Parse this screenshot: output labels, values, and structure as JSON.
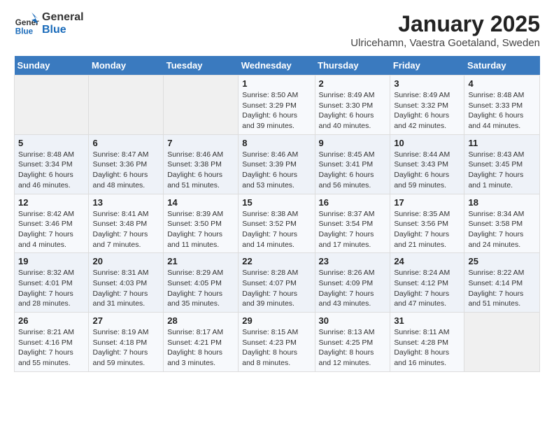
{
  "header": {
    "logo_general": "General",
    "logo_blue": "Blue",
    "title": "January 2025",
    "subtitle": "Ulricehamn, Vaestra Goetaland, Sweden"
  },
  "days_of_week": [
    "Sunday",
    "Monday",
    "Tuesday",
    "Wednesday",
    "Thursday",
    "Friday",
    "Saturday"
  ],
  "weeks": [
    [
      {
        "day": "",
        "info": ""
      },
      {
        "day": "",
        "info": ""
      },
      {
        "day": "",
        "info": ""
      },
      {
        "day": "1",
        "info": "Sunrise: 8:50 AM\nSunset: 3:29 PM\nDaylight: 6 hours and 39 minutes."
      },
      {
        "day": "2",
        "info": "Sunrise: 8:49 AM\nSunset: 3:30 PM\nDaylight: 6 hours and 40 minutes."
      },
      {
        "day": "3",
        "info": "Sunrise: 8:49 AM\nSunset: 3:32 PM\nDaylight: 6 hours and 42 minutes."
      },
      {
        "day": "4",
        "info": "Sunrise: 8:48 AM\nSunset: 3:33 PM\nDaylight: 6 hours and 44 minutes."
      }
    ],
    [
      {
        "day": "5",
        "info": "Sunrise: 8:48 AM\nSunset: 3:34 PM\nDaylight: 6 hours and 46 minutes."
      },
      {
        "day": "6",
        "info": "Sunrise: 8:47 AM\nSunset: 3:36 PM\nDaylight: 6 hours and 48 minutes."
      },
      {
        "day": "7",
        "info": "Sunrise: 8:46 AM\nSunset: 3:38 PM\nDaylight: 6 hours and 51 minutes."
      },
      {
        "day": "8",
        "info": "Sunrise: 8:46 AM\nSunset: 3:39 PM\nDaylight: 6 hours and 53 minutes."
      },
      {
        "day": "9",
        "info": "Sunrise: 8:45 AM\nSunset: 3:41 PM\nDaylight: 6 hours and 56 minutes."
      },
      {
        "day": "10",
        "info": "Sunrise: 8:44 AM\nSunset: 3:43 PM\nDaylight: 6 hours and 59 minutes."
      },
      {
        "day": "11",
        "info": "Sunrise: 8:43 AM\nSunset: 3:45 PM\nDaylight: 7 hours and 1 minute."
      }
    ],
    [
      {
        "day": "12",
        "info": "Sunrise: 8:42 AM\nSunset: 3:46 PM\nDaylight: 7 hours and 4 minutes."
      },
      {
        "day": "13",
        "info": "Sunrise: 8:41 AM\nSunset: 3:48 PM\nDaylight: 7 hours and 7 minutes."
      },
      {
        "day": "14",
        "info": "Sunrise: 8:39 AM\nSunset: 3:50 PM\nDaylight: 7 hours and 11 minutes."
      },
      {
        "day": "15",
        "info": "Sunrise: 8:38 AM\nSunset: 3:52 PM\nDaylight: 7 hours and 14 minutes."
      },
      {
        "day": "16",
        "info": "Sunrise: 8:37 AM\nSunset: 3:54 PM\nDaylight: 7 hours and 17 minutes."
      },
      {
        "day": "17",
        "info": "Sunrise: 8:35 AM\nSunset: 3:56 PM\nDaylight: 7 hours and 21 minutes."
      },
      {
        "day": "18",
        "info": "Sunrise: 8:34 AM\nSunset: 3:58 PM\nDaylight: 7 hours and 24 minutes."
      }
    ],
    [
      {
        "day": "19",
        "info": "Sunrise: 8:32 AM\nSunset: 4:01 PM\nDaylight: 7 hours and 28 minutes."
      },
      {
        "day": "20",
        "info": "Sunrise: 8:31 AM\nSunset: 4:03 PM\nDaylight: 7 hours and 31 minutes."
      },
      {
        "day": "21",
        "info": "Sunrise: 8:29 AM\nSunset: 4:05 PM\nDaylight: 7 hours and 35 minutes."
      },
      {
        "day": "22",
        "info": "Sunrise: 8:28 AM\nSunset: 4:07 PM\nDaylight: 7 hours and 39 minutes."
      },
      {
        "day": "23",
        "info": "Sunrise: 8:26 AM\nSunset: 4:09 PM\nDaylight: 7 hours and 43 minutes."
      },
      {
        "day": "24",
        "info": "Sunrise: 8:24 AM\nSunset: 4:12 PM\nDaylight: 7 hours and 47 minutes."
      },
      {
        "day": "25",
        "info": "Sunrise: 8:22 AM\nSunset: 4:14 PM\nDaylight: 7 hours and 51 minutes."
      }
    ],
    [
      {
        "day": "26",
        "info": "Sunrise: 8:21 AM\nSunset: 4:16 PM\nDaylight: 7 hours and 55 minutes."
      },
      {
        "day": "27",
        "info": "Sunrise: 8:19 AM\nSunset: 4:18 PM\nDaylight: 7 hours and 59 minutes."
      },
      {
        "day": "28",
        "info": "Sunrise: 8:17 AM\nSunset: 4:21 PM\nDaylight: 8 hours and 3 minutes."
      },
      {
        "day": "29",
        "info": "Sunrise: 8:15 AM\nSunset: 4:23 PM\nDaylight: 8 hours and 8 minutes."
      },
      {
        "day": "30",
        "info": "Sunrise: 8:13 AM\nSunset: 4:25 PM\nDaylight: 8 hours and 12 minutes."
      },
      {
        "day": "31",
        "info": "Sunrise: 8:11 AM\nSunset: 4:28 PM\nDaylight: 8 hours and 16 minutes."
      },
      {
        "day": "",
        "info": ""
      }
    ]
  ]
}
